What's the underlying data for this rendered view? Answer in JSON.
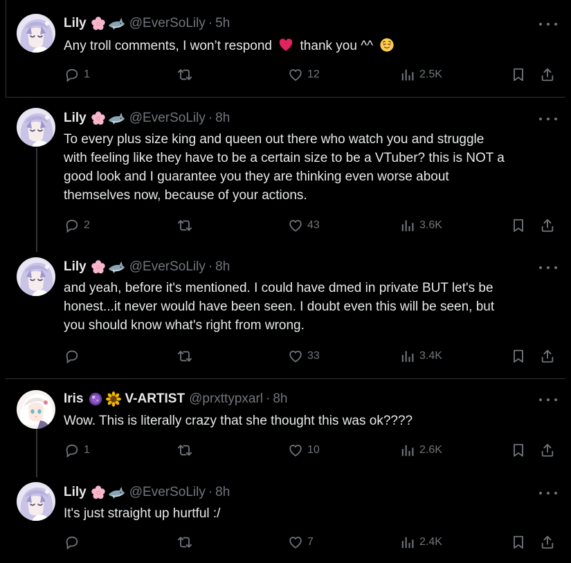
{
  "tweets": [
    {
      "name": "Lily",
      "handle": "@EverSoLily",
      "sep": "·",
      "time": "5h",
      "avatar": "anime-avatar-silver-hair",
      "emojis": [
        "cherry-blossom",
        "shark"
      ],
      "text_lines": [
        "Any troll comments, I won’t respond",
        "thank you ^^"
      ],
      "inline_emojis": [
        "red-heart",
        "relieved-face"
      ],
      "stats": {
        "replies": "1",
        "retweets": "",
        "likes": "12",
        "views": "2.5K"
      }
    },
    {
      "name": "Lily",
      "handle": "@EverSoLily",
      "sep": "·",
      "time": "8h",
      "avatar": "anime-avatar-silver-hair",
      "emojis": [
        "cherry-blossom",
        "shark"
      ],
      "text_lines": [
        "To every plus size king and queen out there who watch you and struggle",
        "with feeling like they have to be a certain size to be a VTuber? this is NOT a",
        "good look and I guarantee you they are thinking even worse about",
        "themselves now, because of your actions."
      ],
      "stats": {
        "replies": "2",
        "retweets": "",
        "likes": "43",
        "views": "3.6K"
      }
    },
    {
      "name": "Lily",
      "handle": "@EverSoLily",
      "sep": "·",
      "time": "8h",
      "avatar": "anime-avatar-silver-hair",
      "emojis": [
        "cherry-blossom",
        "shark"
      ],
      "text_lines": [
        "and yeah, before it's mentioned. I could have dmed in private BUT let's be",
        "honest...it never would have been seen. I doubt even this will be seen, but",
        "you should know what's right from wrong."
      ],
      "stats": {
        "replies": "",
        "retweets": "",
        "likes": "33",
        "views": "3.4K"
      }
    },
    {
      "name": "Iris",
      "handle": "@prxttypxarl",
      "sep": "·",
      "time": "8h",
      "avatar": "anime-avatar-white-hair",
      "emojis": [
        "purple-orb",
        "sunflower"
      ],
      "name_suffix": "V-ARTIST",
      "text_lines": [
        "Wow. This is literally crazy that she thought this was ok????"
      ],
      "stats": {
        "replies": "1",
        "retweets": "",
        "likes": "10",
        "views": "2.6K"
      }
    },
    {
      "name": "Lily",
      "handle": "@EverSoLily",
      "sep": "·",
      "time": "8h",
      "avatar": "anime-avatar-silver-hair",
      "emojis": [
        "cherry-blossom",
        "shark"
      ],
      "text_lines": [
        "It's just straight up hurtful :/"
      ],
      "stats": {
        "replies": "",
        "retweets": "",
        "likes": "7",
        "views": "2.4K"
      }
    }
  ],
  "colors": {
    "background": "#000000",
    "text": "#e7e9ea",
    "muted": "#71767b",
    "divider": "#2f3336",
    "heart": "#f91880"
  }
}
